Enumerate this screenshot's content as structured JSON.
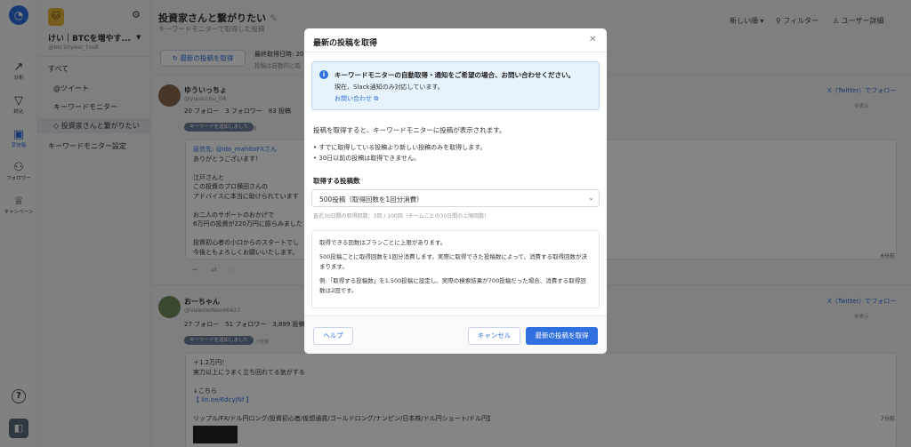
{
  "rail": {
    "items": [
      {
        "icon": "chart-icon",
        "label": "分析"
      },
      {
        "icon": "funnel-icon",
        "label": "絞込"
      },
      {
        "icon": "inbox-icon",
        "label": "受信箱"
      },
      {
        "icon": "users-icon",
        "label": "フォロワー"
      },
      {
        "icon": "trophy-icon",
        "label": "キャンペーン"
      }
    ]
  },
  "sidebar": {
    "account_name": "けい｜BTCを増やす...",
    "account_handle": "@btc10year_hodl",
    "nav": [
      {
        "label": "すべて"
      },
      {
        "label": "@ツイート"
      },
      {
        "label": "キーワードモニター"
      },
      {
        "label": "投資家さんと繋がりたい"
      },
      {
        "label": "キーワードモニター設定"
      }
    ]
  },
  "header": {
    "title": "投資家さんと繋がりたい",
    "subtitle": "キーワードモニターで取得した投稿",
    "sort": "新しい順",
    "filter": "フィルター",
    "user_detail": "ユーザー詳細"
  },
  "toolbar": {
    "fetch_button": "最新の投稿を取得",
    "last_fetch": "最終取得日時: 20",
    "fetch_note": "投稿は自動的に取"
  },
  "posts": [
    {
      "name": "ゆういっちょ",
      "handle": "@yuuicchu_04",
      "stats": "20 フォロー　3 フォロワー　83 投稿",
      "tag": "キーワードを追加しました",
      "tag_ago": "6分前",
      "x_follow": "X（Twitter）でフォロー",
      "undisplay": "非表示",
      "lines": [
        "返信先: @ido_mahitoFXさん",
        "ありがとうございます！",
        "",
        "江戸さんと",
        "この投資のプロ横田さんの",
        "アドバイスに本当に助けられています",
        "",
        "お二人のサポートのおかげで",
        "6万円の投資が220万円に膨らみました",
        "",
        "投資初心者の小口からのスタートでし",
        "今後ともよろしくお願いいたします。"
      ],
      "ago": "6分前"
    },
    {
      "name": "おーちゃん",
      "handle": "@ValerieWee46427",
      "stats": "27 フォロー　51 フォロワー　3,899 投稿",
      "tag": "キーワードを追加しました",
      "tag_ago": "7分前",
      "x_follow": "X（Twitter）でフォロー",
      "undisplay": "非表示",
      "lines": [
        "＋1.2万円！",
        "実力以上にうまく立ち回れてる気がする",
        "",
        "↓こちら",
        "【 lin.ee/6dcyjNf 】",
        "",
        "リップル/FX/ドル円ロング/投資初心者/仮想通貨/ゴールドロング/ナンピン/日本株/ドル円ショート/ドル円】"
      ],
      "ago": "7分前"
    }
  ],
  "modal": {
    "title": "最新の投稿を取得",
    "info_title": "キーワードモニターの自動取得・通知をご希望の場合、お問い合わせください。",
    "info_text": "現在、Slack通知のみ対応しています。",
    "info_link": "お問い合わせ",
    "description": "投稿を取得すると、キーワードモニターに投稿が表示されます。",
    "bullets": [
      "すでに取得している投稿より新しい投稿のみを取得します。",
      "30日以前の投稿は取得できません。"
    ],
    "select_label": "取得する投稿数",
    "select_value": "500投稿（取得回数を1回分消費）",
    "select_hint": "直近30日間の取得回数：3回 / 100回（チームごとの30日間の上限回数）",
    "notes": [
      "取得できる回数はプランごとに上限があります。",
      "500投稿ごとに取得回数を1回分消費します。実際に取得できた投稿数によって、消費する取得回数が決まります。",
      "例:「取得する投稿数」を1,500投稿に設定し、実際の検索結果が700投稿だった場合、消費する取得回数は2回です。"
    ],
    "help_button": "ヘルプ",
    "cancel_button": "キャンセル",
    "fetch_button": "最新の投稿を取得"
  },
  "colors": {
    "accent": "#2f6fde",
    "info_bg": "#e6f2fc"
  }
}
